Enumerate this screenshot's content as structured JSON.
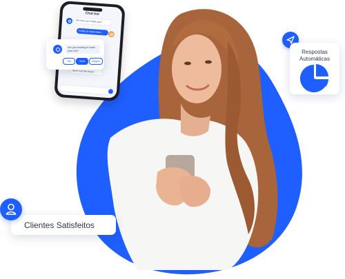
{
  "colors": {
    "accent": "#1f5fff",
    "card": "#ffffff",
    "text": "#2f3644"
  },
  "phone": {
    "title": "Chat bot",
    "messages": [
      {
        "from": "bot",
        "text": "Hi! How can I help you?"
      },
      {
        "from": "user",
        "text": "I'd like to know more"
      },
      {
        "from": "bot",
        "text": "Sure! Let me check"
      }
    ]
  },
  "chat_card": {
    "question": "Are you looking to build your bot?",
    "options": [
      "Yes",
      "Sure",
      "Maybe"
    ],
    "active_option": 1
  },
  "respostas_card": {
    "line1": "Respostas",
    "line2": "Automáticas",
    "icon": "pie-chart-icon",
    "badge_icon": "send-icon"
  },
  "clients": {
    "label": "Clientes Satisfeitos",
    "icon": "user-icon"
  }
}
